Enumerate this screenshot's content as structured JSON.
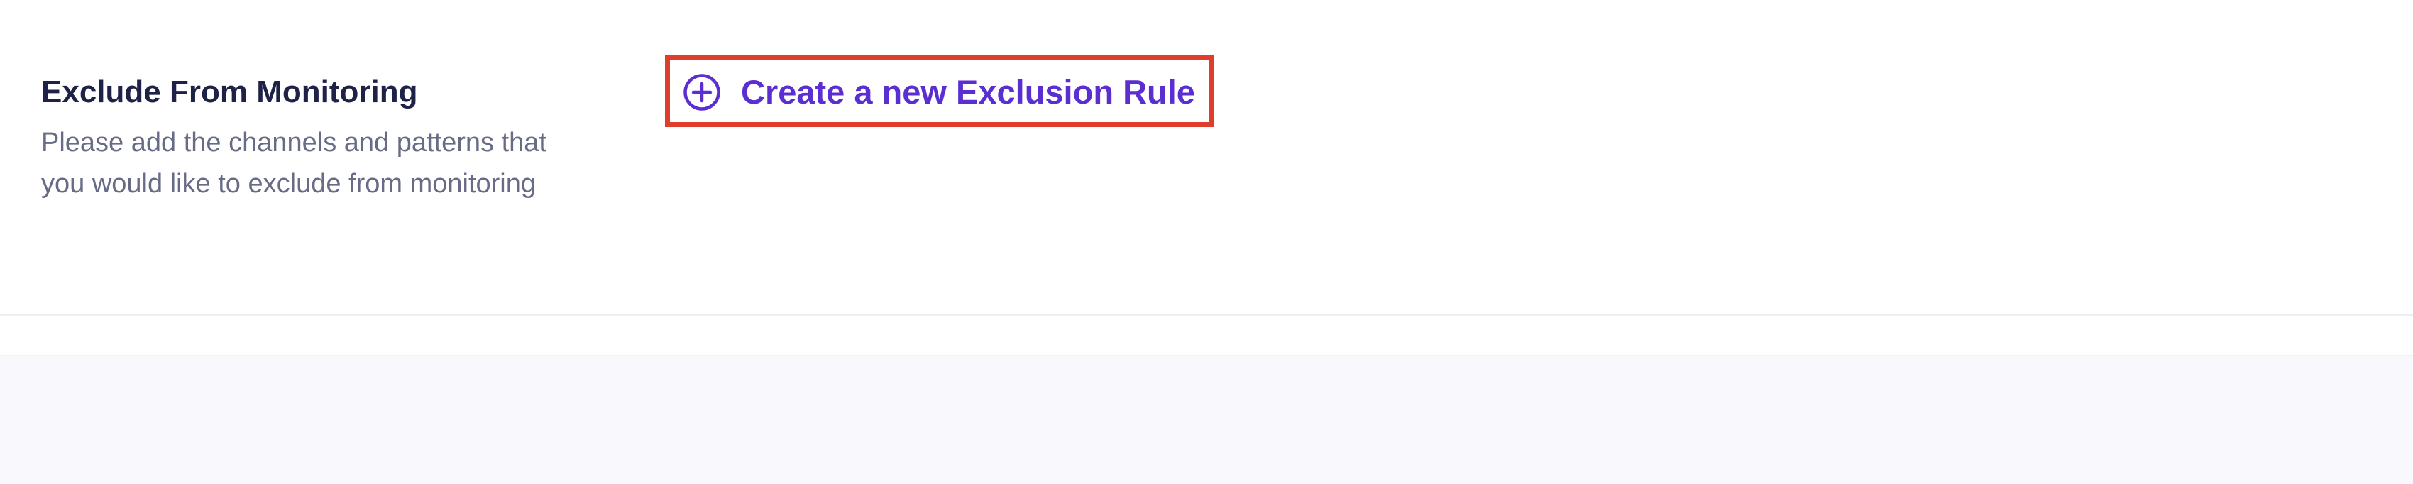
{
  "section": {
    "title": "Exclude From Monitoring",
    "description": "Please add the channels and patterns that you would like to exclude from monitoring"
  },
  "actions": {
    "create_rule_label": "Create a new Exclusion Rule",
    "create_rule_icon": "plus-circle-icon"
  },
  "colors": {
    "accent": "#5b2ed1",
    "highlight": "#e03e2d",
    "title": "#1f2247",
    "description": "#676b86",
    "footer_background": "#f9f9fd"
  }
}
